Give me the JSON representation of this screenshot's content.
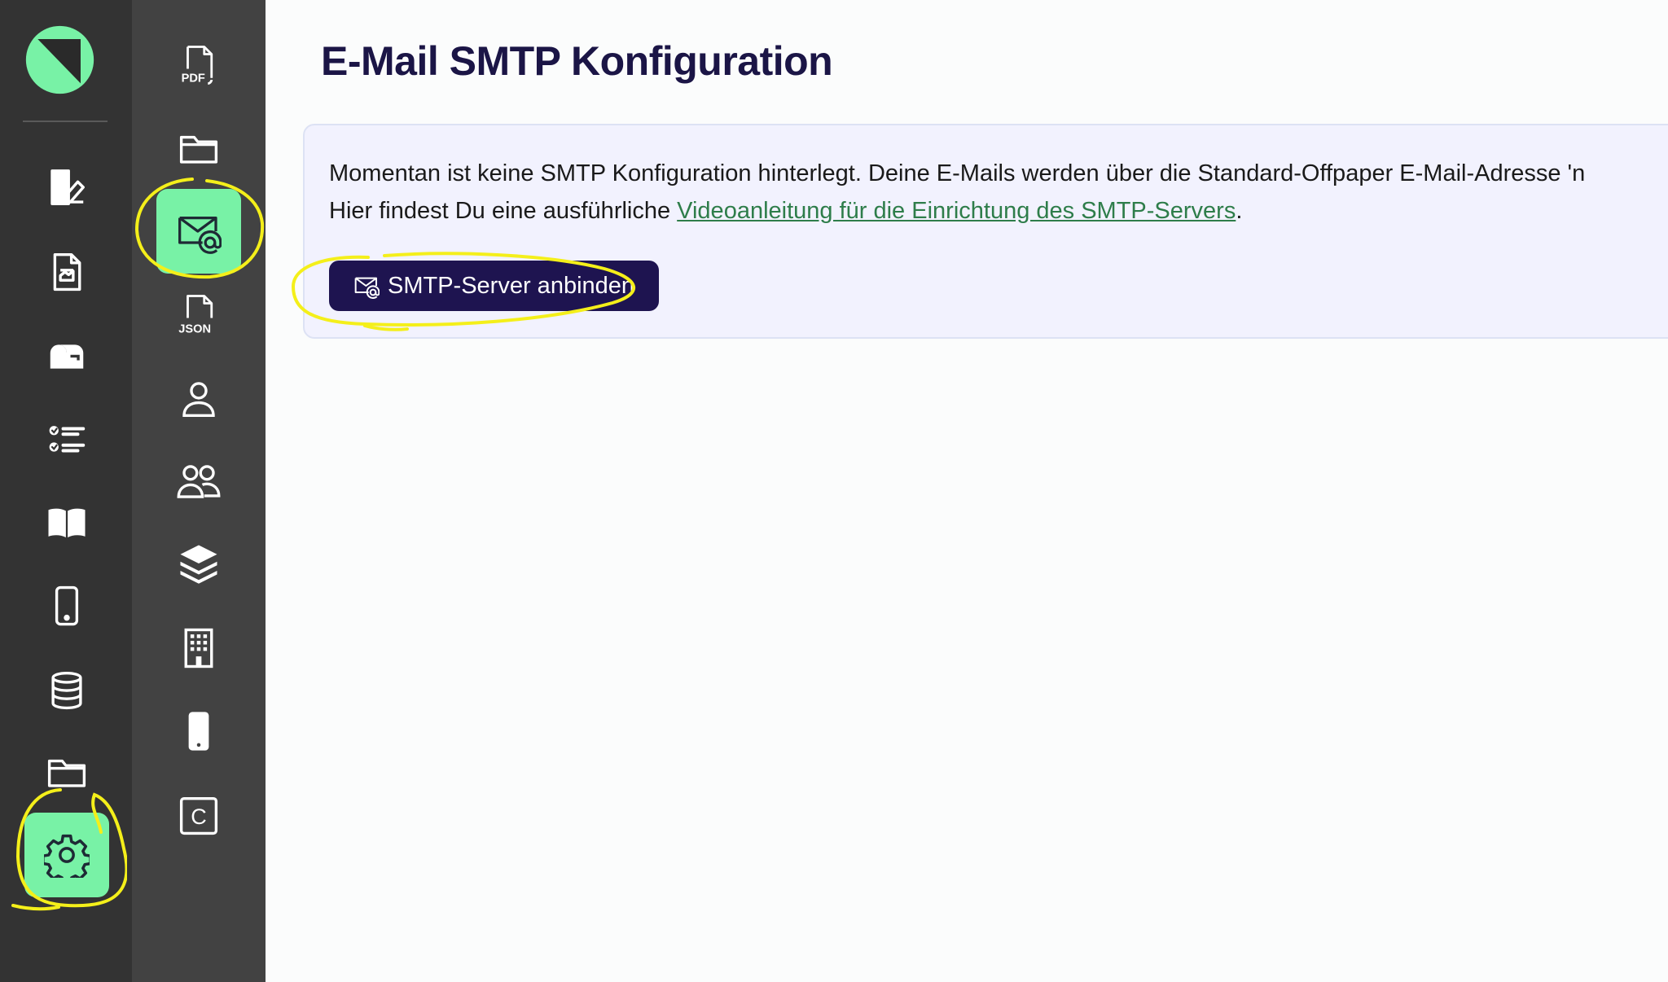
{
  "page": {
    "title": "E-Mail SMTP Konfiguration"
  },
  "info": {
    "line1": "Momentan ist keine SMTP Konfiguration hinterlegt. Deine E-Mails werden über die Standard-Offpaper E-Mail-Adresse 'n",
    "line2_prefix": "Hier findest Du eine ausführliche ",
    "link_label": "Videoanleitung für die Einrichtung des SMTP-Servers",
    "line2_suffix": "."
  },
  "actions": {
    "connect_smtp_label": "SMTP-Server anbinden"
  },
  "sidebar_primary": {
    "items": [
      {
        "icon": "form-edit-icon"
      },
      {
        "icon": "document-icon"
      },
      {
        "icon": "mailbox-icon"
      },
      {
        "icon": "checklist-icon"
      },
      {
        "icon": "book-icon"
      },
      {
        "icon": "smartphone-icon"
      },
      {
        "icon": "database-icon"
      },
      {
        "icon": "folder-icon"
      },
      {
        "icon": "gear-icon",
        "active": true
      }
    ]
  },
  "sidebar_secondary": {
    "items": [
      {
        "icon": "pdf-file-icon",
        "caption": "PDF"
      },
      {
        "icon": "folder-open-icon"
      },
      {
        "icon": "mail-at-icon",
        "active": true
      },
      {
        "icon": "json-file-icon",
        "caption": "JSON"
      },
      {
        "icon": "user-icon"
      },
      {
        "icon": "users-icon"
      },
      {
        "icon": "layers-icon"
      },
      {
        "icon": "building-icon"
      },
      {
        "icon": "phone-icon"
      },
      {
        "icon": "c-square-icon",
        "caption": "C"
      }
    ]
  },
  "colors": {
    "accent": "#78f2a6",
    "primary": "#1e1450",
    "sidebar_primary": "#333333",
    "sidebar_secondary": "#424242",
    "link": "#2e7d4a",
    "highlight": "#f4ef1a"
  }
}
